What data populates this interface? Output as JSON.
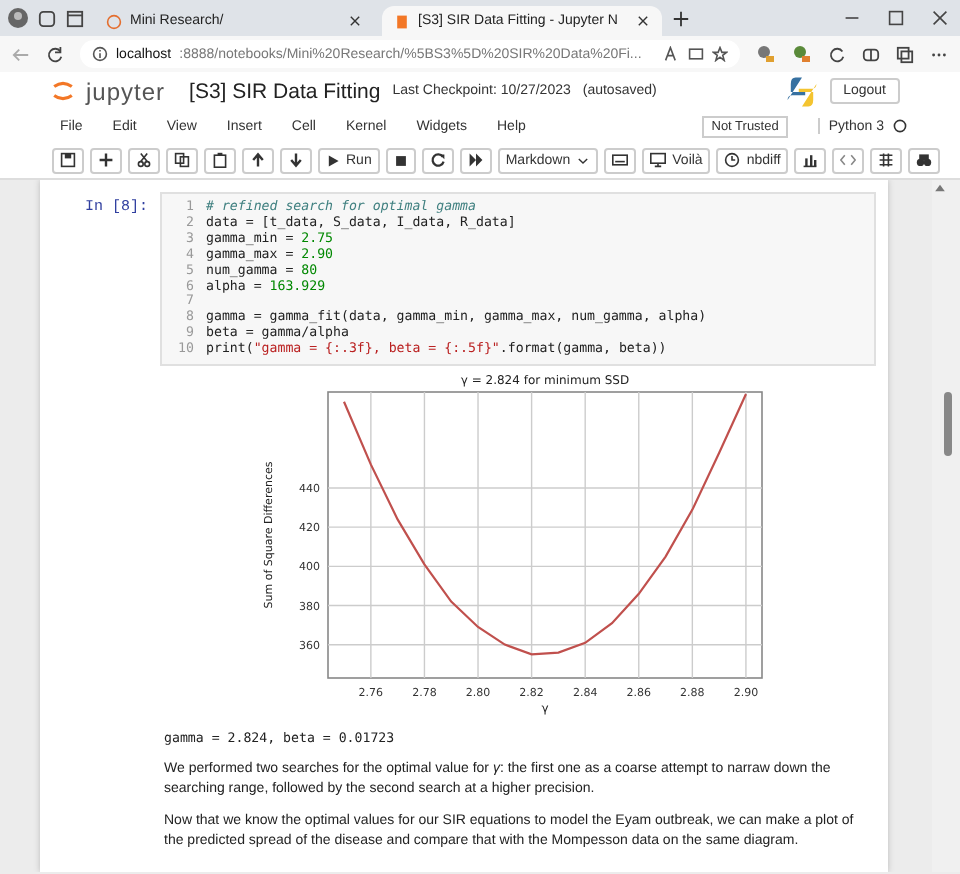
{
  "browser": {
    "tabs": [
      {
        "title": "Mini Research/",
        "selected": false
      },
      {
        "title": "[S3] SIR Data Fitting - Jupyter N",
        "selected": true
      }
    ],
    "address_host": "localhost",
    "address_rest": ":8888/notebooks/Mini%20Research/%5BS3%5D%20SIR%20Data%20Fi..."
  },
  "jupyter": {
    "logo_text": "jupyter",
    "notebook_title": "[S3] SIR Data Fitting",
    "checkpoint": "Last Checkpoint: 10/27/2023",
    "autosave": "(autosaved)",
    "logout": "Logout",
    "menu": [
      "File",
      "Edit",
      "View",
      "Insert",
      "Cell",
      "Kernel",
      "Widgets",
      "Help"
    ],
    "trust": "Not Trusted",
    "kernel": "Python 3",
    "toolbar": {
      "run": "Run",
      "cell_type": "Markdown",
      "voila": "Voilà",
      "nbdiff": "nbdiff"
    }
  },
  "cell": {
    "prompt": "In [8]:",
    "lines": [
      {
        "number": "1",
        "tokens": [
          {
            "text": "# refined search for optimal gamma",
            "kind": "comment"
          }
        ]
      },
      {
        "number": "2",
        "tokens": [
          {
            "text": "data = [t_data, S_data, I_data, R_data]",
            "kind": "plain"
          }
        ]
      },
      {
        "number": "3",
        "tokens": [
          {
            "text": "gamma_min = ",
            "kind": "plain"
          },
          {
            "text": "2.75",
            "kind": "number"
          }
        ]
      },
      {
        "number": "4",
        "tokens": [
          {
            "text": "gamma_max = ",
            "kind": "plain"
          },
          {
            "text": "2.90",
            "kind": "number"
          }
        ]
      },
      {
        "number": "5",
        "tokens": [
          {
            "text": "num_gamma = ",
            "kind": "plain"
          },
          {
            "text": "80",
            "kind": "number"
          }
        ]
      },
      {
        "number": "6",
        "tokens": [
          {
            "text": "alpha = ",
            "kind": "plain"
          },
          {
            "text": "163.929",
            "kind": "number"
          }
        ]
      },
      {
        "number": "7"
      },
      {
        "number": "8",
        "tokens": [
          {
            "text": "gamma = gamma_fit(data, gamma_min, gamma_max, num_gamma, alpha)",
            "kind": "plain"
          }
        ]
      },
      {
        "number": "9",
        "tokens": [
          {
            "text": "beta = gamma/alpha",
            "kind": "plain"
          }
        ]
      },
      {
        "number": "10",
        "tokens": [
          {
            "text": "print(",
            "kind": "plain"
          },
          {
            "text": "\"gamma = {:.3f}, beta = {:.5f}\"",
            "kind": "string"
          },
          {
            "text": ".format(gamma, beta))",
            "kind": "plain"
          }
        ]
      }
    ]
  },
  "chart_data": {
    "type": "line",
    "title": "γ = 2.824 for minimum SSD",
    "xlabel": "γ",
    "ylabel": "Sum of Square Differences",
    "x": [
      2.75,
      2.76,
      2.77,
      2.78,
      2.79,
      2.8,
      2.81,
      2.82,
      2.83,
      2.84,
      2.85,
      2.86,
      2.87,
      2.88,
      2.89,
      2.9
    ],
    "series": [
      {
        "color": "#c0504d",
        "values": [
          484,
          452,
          424,
          401,
          382,
          369,
          360,
          355,
          356,
          361,
          371,
          386,
          405,
          429,
          458,
          488
        ]
      }
    ],
    "grid": true,
    "xlim": [
      2.744,
      2.906
    ],
    "ylim": [
      343,
      489
    ],
    "xticks": [
      {
        "value": 2.76,
        "label": "2.76"
      },
      {
        "value": 2.78,
        "label": "2.78"
      },
      {
        "value": 2.8,
        "label": "2.80"
      },
      {
        "value": 2.82,
        "label": "2.82"
      },
      {
        "value": 2.84,
        "label": "2.84"
      },
      {
        "value": 2.86,
        "label": "2.86"
      },
      {
        "value": 2.88,
        "label": "2.88"
      },
      {
        "value": 2.9,
        "label": "2.90"
      }
    ],
    "yticks": [
      360,
      380,
      400,
      420,
      440
    ]
  },
  "output": "gamma = 2.824, beta = 0.01723",
  "paragraphs": [
    "We performed two searches for the optimal value for *γ*: the first one as a coarse attempt to narraw down the searching range, followed by the second search at a higher precision.",
    "Now that we know the optimal values for our SIR equations to model the Eyam outbreak, we can make a plot of the predicted spread of the disease and compare that with the Mompesson data on the same diagram."
  ]
}
